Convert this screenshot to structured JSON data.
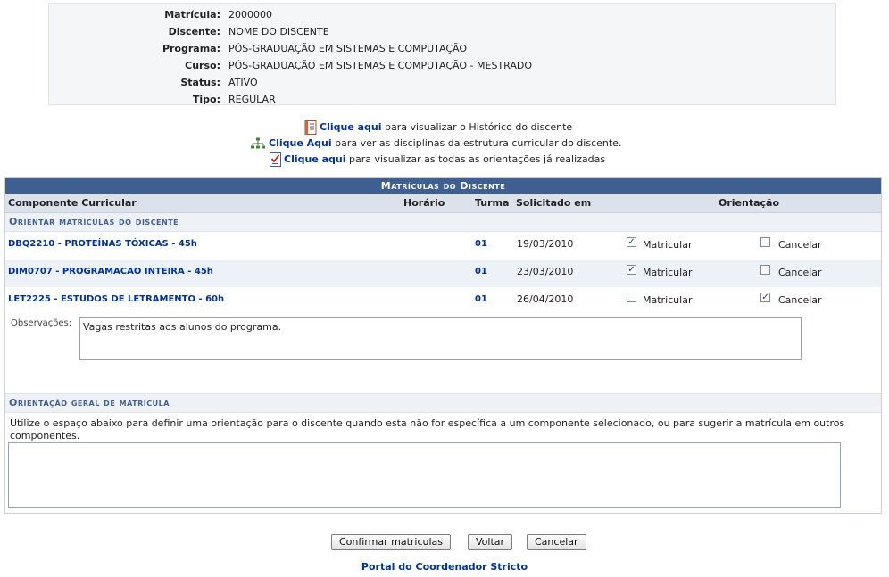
{
  "student_info": [
    {
      "label": "Matrícula:",
      "value": "2000000"
    },
    {
      "label": "Discente:",
      "value": "NOME DO DISCENTE"
    },
    {
      "label": "Programa:",
      "value": "PÓS-GRADUAÇÃO EM SISTEMAS E COMPUTAÇÃO"
    },
    {
      "label": "Curso:",
      "value": "PÓS-GRADUAÇÃO EM SISTEMAS E COMPUTAÇÃO - MESTRADO"
    },
    {
      "label": "Status:",
      "value": "ATIVO"
    },
    {
      "label": "Tipo:",
      "value": "REGULAR"
    }
  ],
  "links": [
    {
      "link": "Clique aqui",
      "text": " para visualizar o Histórico do discente",
      "icon": "document-list-icon"
    },
    {
      "link": "Clique Aqui",
      "text": " para ver as disciplinas da estrutura curricular do discente.",
      "icon": "tree-structure-icon"
    },
    {
      "link": "Clique aqui",
      "text": " para visualizar as todas as orientações já realizadas",
      "icon": "checklist-icon"
    }
  ],
  "table": {
    "caption": "Matrículas do Discente",
    "headers": {
      "componente": "Componente Curricular",
      "horario": "Horário",
      "turma": "Turma",
      "solicitado": "Solicitado em",
      "orientacao": "Orientação"
    },
    "section_title": "Orientar matrículas do discente",
    "matricular_label": "Matricular",
    "cancelar_label": "Cancelar",
    "rows": [
      {
        "componente": "DBQ2210 - PROTEÍNAS TÓXICAS - 45h",
        "turma": "01",
        "solicitado": "19/03/2010",
        "matricular": true,
        "cancelar": false
      },
      {
        "componente": "DIM0707 - PROGRAMACAO INTEIRA - 45h",
        "turma": "01",
        "solicitado": "23/03/2010",
        "matricular": true,
        "cancelar": false
      },
      {
        "componente": "LET2225 - ESTUDOS DE LETRAMENTO - 60h",
        "turma": "01",
        "solicitado": "26/04/2010",
        "matricular": false,
        "cancelar": true
      }
    ],
    "observacoes_label": "Observações:",
    "observacoes_value": "Vagas restritas aos alunos do programa."
  },
  "general": {
    "title": "Orientação geral de matrícula",
    "instructions": "Utilize o espaço abaixo para definir uma orientação para o discente quando esta não for específica a um componente selecionado, ou para sugerir a matrícula em outros componentes.",
    "value": ""
  },
  "buttons": {
    "confirmar": "Confirmar matriculas",
    "voltar": "Voltar",
    "cancelar": "Cancelar"
  },
  "footer_link": "Portal do Coordenador Stricto"
}
